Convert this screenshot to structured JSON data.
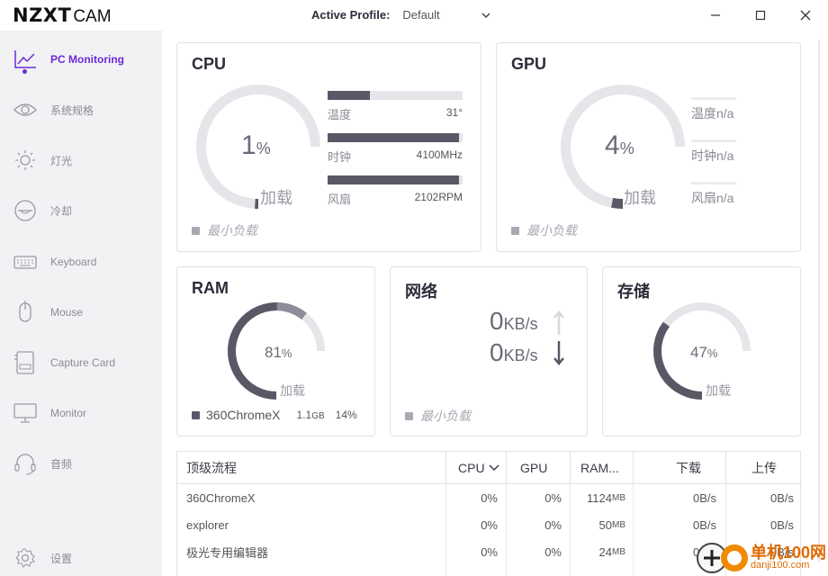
{
  "app": {
    "logo_main": "NZXT",
    "logo_sub": "CAM"
  },
  "header": {
    "profile_label": "Active Profile:",
    "profile_value": "Default"
  },
  "sidebar": {
    "items": [
      {
        "label": "PC Monitoring",
        "icon": "line-chart-icon"
      },
      {
        "label": "系统规格",
        "icon": "eye-icon"
      },
      {
        "label": "灯光",
        "icon": "sun-icon"
      },
      {
        "label": "冷却",
        "icon": "cooler-icon"
      },
      {
        "label": "Keyboard",
        "icon": "keyboard-icon"
      },
      {
        "label": "Mouse",
        "icon": "mouse-icon"
      },
      {
        "label": "Capture Card",
        "icon": "capture-card-icon"
      },
      {
        "label": "Monitor",
        "icon": "monitor-icon"
      },
      {
        "label": "音频",
        "icon": "headset-icon"
      }
    ],
    "settings_label": "设置"
  },
  "cpu": {
    "title": "CPU",
    "load_value": "1",
    "load_unit": "%",
    "load_label": "加载",
    "load_fraction": 0.01,
    "legend": "最小负载",
    "stats": [
      {
        "label": "温度",
        "value": "31°",
        "fill": 0.31
      },
      {
        "label": "时钟",
        "value": "4100MHz",
        "fill": 0.97
      },
      {
        "label": "风扇",
        "value": "2102RPM",
        "fill": 0.97
      }
    ]
  },
  "gpu": {
    "title": "GPU",
    "load_value": "4",
    "load_unit": "%",
    "load_label": "加载",
    "load_fraction": 0.04,
    "legend": "最小负载",
    "stats": [
      {
        "label": "温度",
        "value": "n/a"
      },
      {
        "label": "时钟",
        "value": "n/a"
      },
      {
        "label": "风扇",
        "value": "n/a"
      }
    ]
  },
  "ram": {
    "title": "RAM",
    "load_value": "81",
    "load_unit": "%",
    "load_label": "加载",
    "load_fraction": 0.81,
    "process_fraction": 0.14,
    "legend_name": "360ChromeX",
    "legend_size": "1.1",
    "legend_size_unit": "GB",
    "legend_pct": "14%"
  },
  "network": {
    "title": "网络",
    "down_value": "0",
    "up_value": "0",
    "unit": "KB/s",
    "legend": "最小负载"
  },
  "storage": {
    "title": "存储",
    "load_value": "47",
    "load_unit": "%",
    "load_label": "加载",
    "load_fraction": 0.47
  },
  "table": {
    "headers": [
      "顶级流程",
      "CPU",
      "GPU",
      "RAM...",
      "下载",
      "上传"
    ],
    "rows": [
      {
        "name": "360ChromeX",
        "cpu": "0%",
        "gpu": "0%",
        "ram": "1124",
        "down": "0B/s",
        "up": "0B/s"
      },
      {
        "name": "explorer",
        "cpu": "0%",
        "gpu": "0%",
        "ram": "50",
        "down": "0B/s",
        "up": "0B/s"
      },
      {
        "name": "极光专用编辑器",
        "cpu": "0%",
        "gpu": "0%",
        "ram": "24",
        "down": "0B/s",
        "up": "0B/s"
      }
    ],
    "ram_unit": "MB"
  },
  "watermark": {
    "title": "单机100网",
    "url": "danji100.com"
  },
  "colors": {
    "accent": "#6b2bd6",
    "gauge_track": "#e6e6ea",
    "gauge_fill": "#5a5866"
  }
}
